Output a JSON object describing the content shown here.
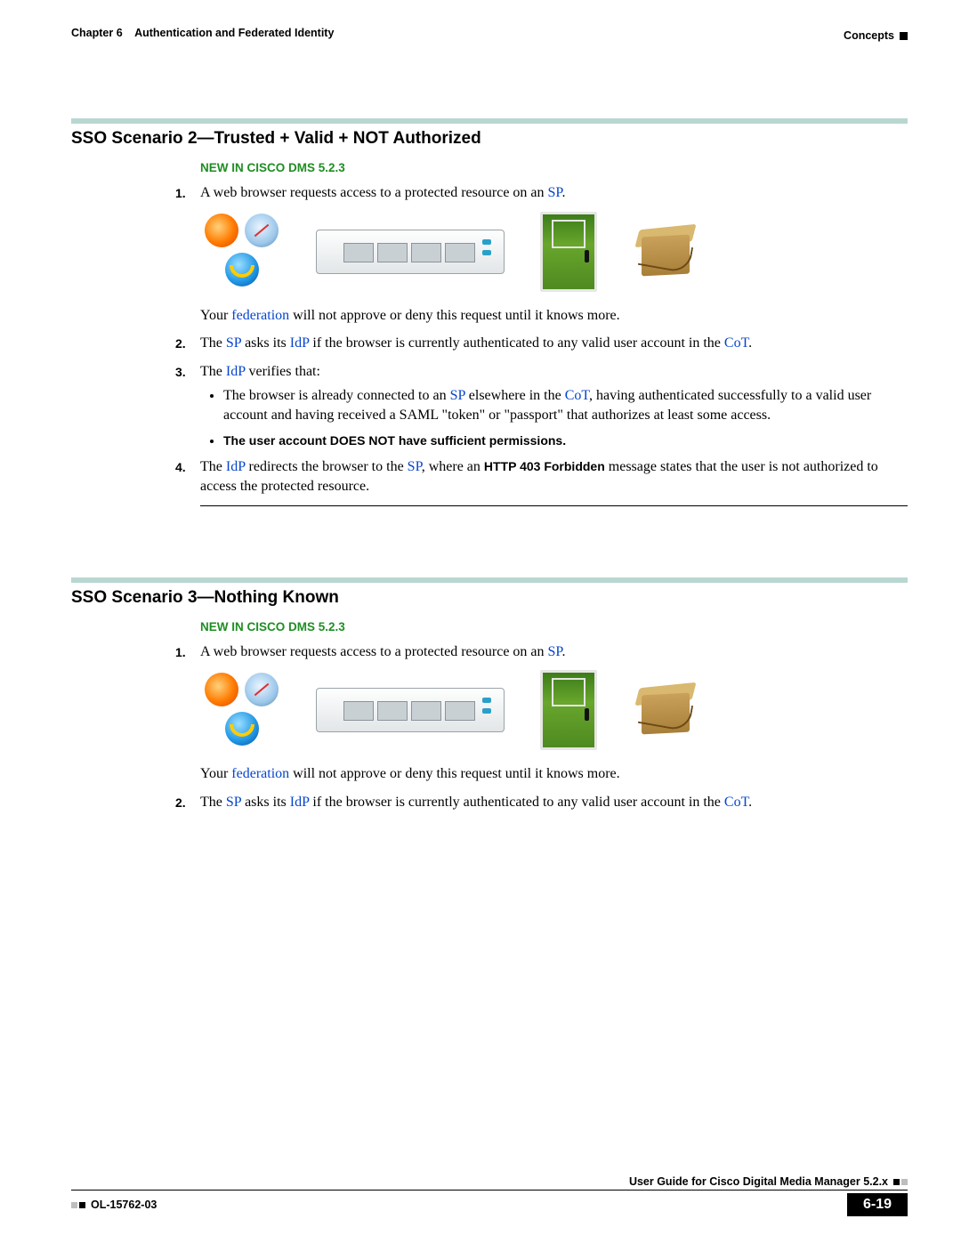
{
  "header": {
    "chapter": "Chapter 6",
    "title": "Authentication and Federated Identity",
    "section": "Concepts"
  },
  "sections": {
    "s2": {
      "heading": "SSO Scenario 2—Trusted + Valid + NOT Authorized",
      "new_tag": "NEW IN CISCO DMS 5.2.3",
      "step1_a": "A web browser requests access to a protected resource on an ",
      "sp": "SP",
      "after_sp": ".",
      "fed_line_a": "Your ",
      "federation": "federation",
      "fed_line_b": " will not approve or deny this request until it knows more.",
      "step2_a": "The ",
      "step2_b": " asks its ",
      "idp": "IdP",
      "step2_c": " if the browser is currently authenticated to any valid user account in the ",
      "cot": "CoT",
      "step3_a": "The ",
      "step3_b": " verifies that:",
      "bullet1_a": "The browser is already connected to an ",
      "bullet1_b": " elsewhere in the ",
      "bullet1_c": ", having authenticated successfully to a valid user account and having received a SAML \"token\" or \"passport\" that authorizes at least some access.",
      "bullet2": "The user account DOES NOT have sufficient permissions.",
      "step4_a": "The ",
      "step4_b": " redirects the browser to the ",
      "step4_c": ", where an ",
      "http403": "HTTP 403 Forbidden",
      "step4_d": " message states that the user is not authorized to access the protected resource."
    },
    "s3": {
      "heading": "SSO Scenario 3—Nothing Known",
      "new_tag": "NEW IN CISCO DMS 5.2.3",
      "step1_a": "A web browser requests access to a protected resource on an ",
      "fed_line_a": "Your ",
      "fed_line_b": " will not approve or deny this request until it knows more.",
      "step2_a": "The ",
      "step2_b": " asks its ",
      "step2_c": " if the browser is currently authenticated to any valid user account in the "
    }
  },
  "footer": {
    "guide": "User Guide for Cisco Digital Media Manager 5.2.x",
    "docnum": "OL-15762-03",
    "pagenum": "6-19"
  }
}
